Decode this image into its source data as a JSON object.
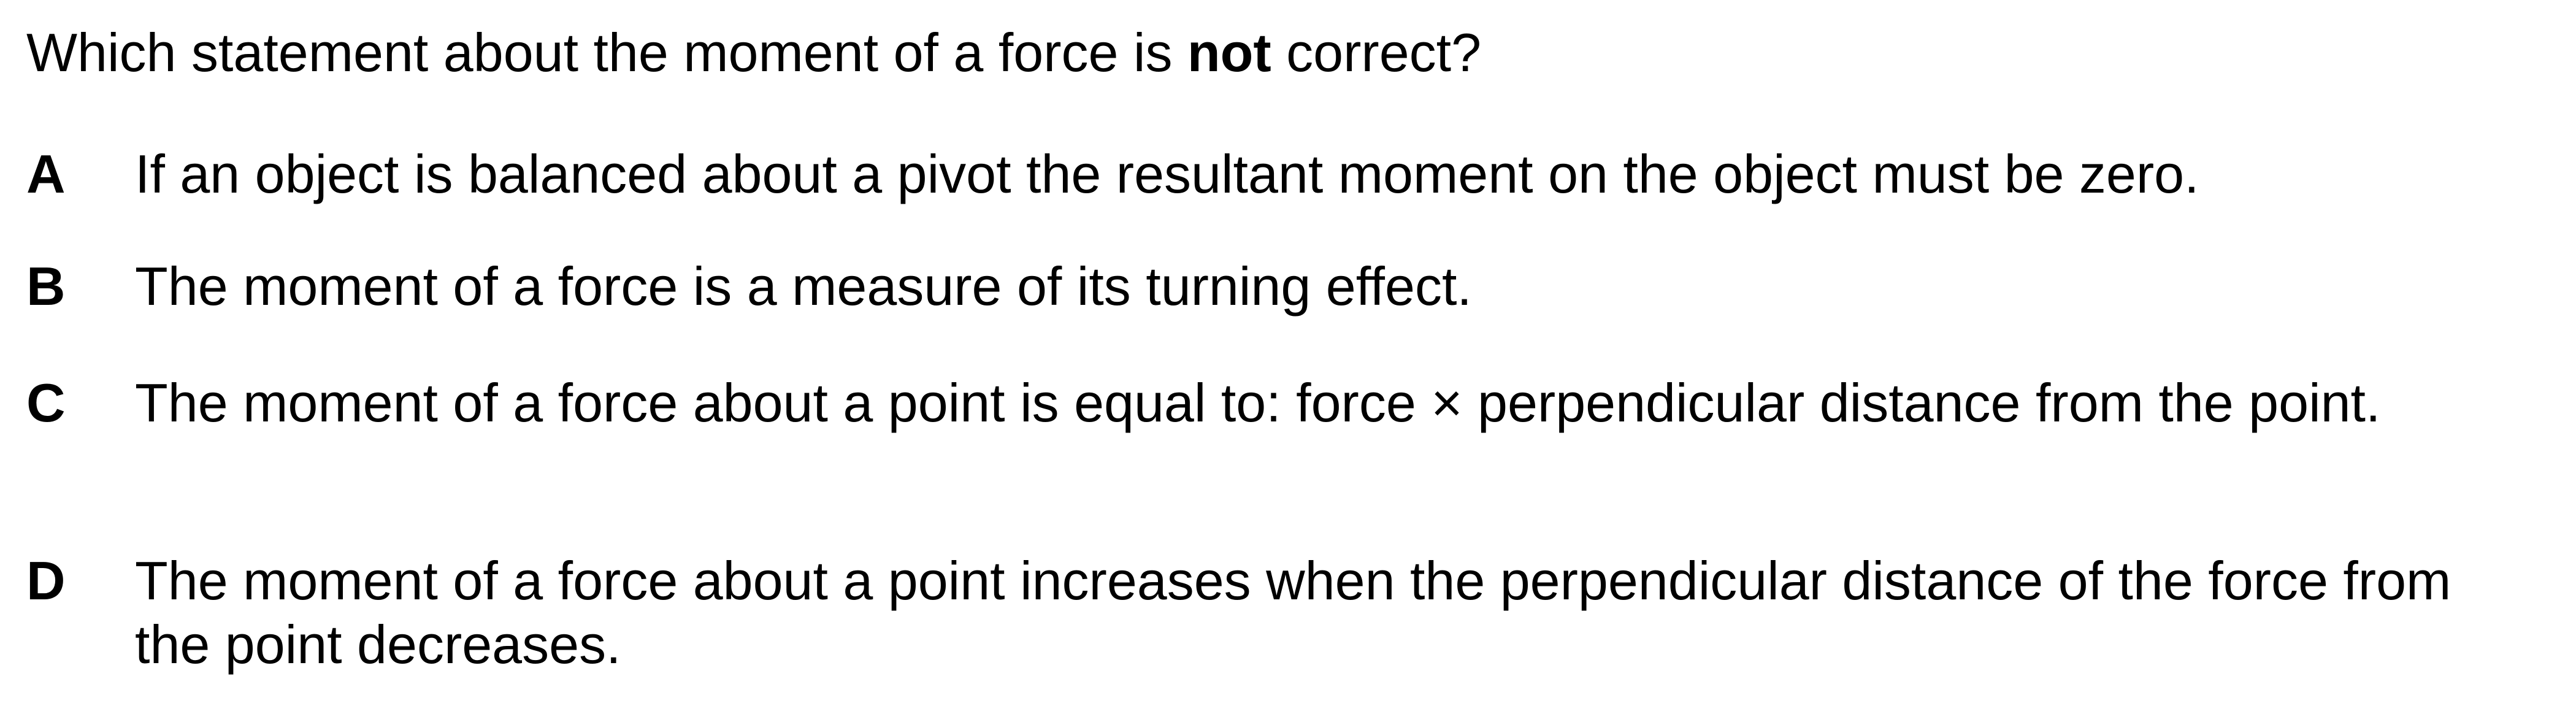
{
  "question": {
    "stem_before": "Which statement about the moment of a force is ",
    "stem_emphasis": "not",
    "stem_after": " correct?"
  },
  "options": [
    {
      "letter": "A",
      "text": "If an object is balanced about a pivot the resultant moment on the object must be zero."
    },
    {
      "letter": "B",
      "text": "The moment of a force is a measure of its turning effect."
    },
    {
      "letter": "C",
      "text": "The moment of a force about a point is equal to: force × perpendicular distance from the point."
    },
    {
      "letter": "D",
      "text": "The moment of a force about a point increases when the perpendicular distance of the force from the point decreases."
    }
  ]
}
